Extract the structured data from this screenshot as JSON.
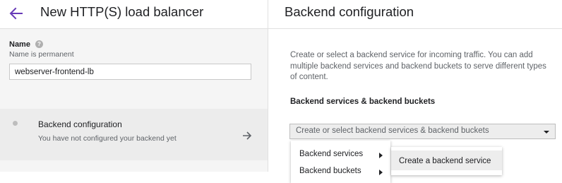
{
  "left_panel": {
    "title": "New HTTP(S) load balancer",
    "name_field": {
      "label": "Name",
      "hint": "Name is permanent",
      "value": "webserver-frontend-lb"
    },
    "step": {
      "title": "Backend configuration",
      "subtitle": "You have not configured your backend yet"
    }
  },
  "right_panel": {
    "title": "Backend configuration",
    "description": "Create or select a backend service for incoming traffic. You can add multiple backend services and backend buckets to serve different types of content.",
    "section_label": "Backend services & backend buckets",
    "select": {
      "placeholder": "Create or select backend services & backend buckets"
    },
    "menu": {
      "items": [
        {
          "label": "Backend services"
        },
        {
          "label": "Backend buckets"
        }
      ]
    },
    "submenu": {
      "items": [
        {
          "label": "Create a backend service"
        }
      ]
    }
  },
  "colors": {
    "accent": "#673ab7",
    "left_background": "#f5f5f5",
    "step_background": "#ececec"
  }
}
